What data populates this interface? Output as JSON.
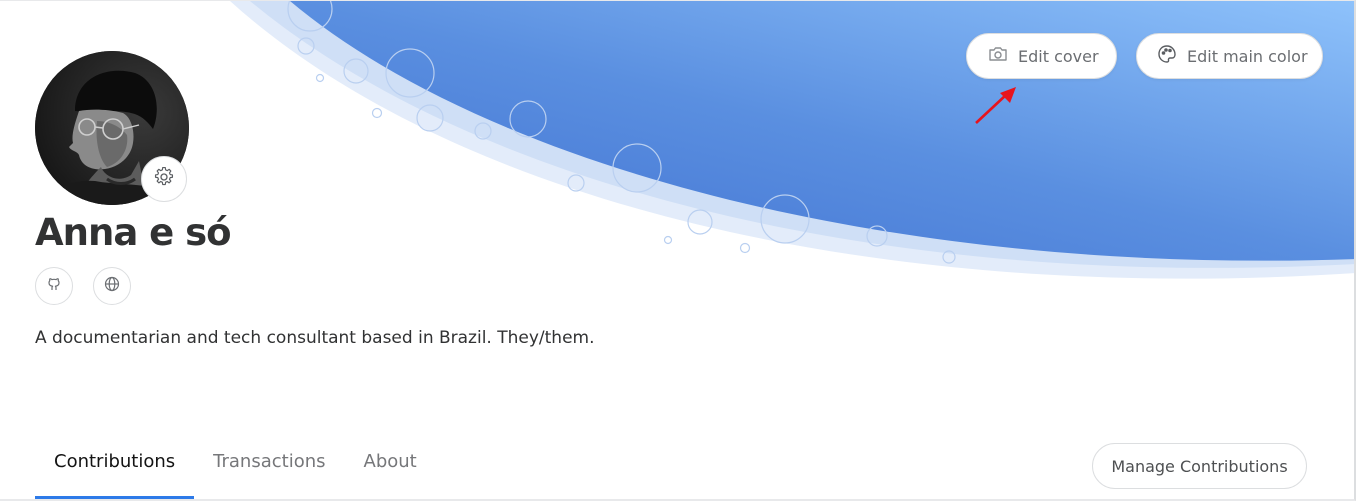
{
  "profile": {
    "name": "Anna e só",
    "bio": "A documentarian and tech consultant based in Brazil. They/them."
  },
  "cover_actions": {
    "edit_cover": "Edit cover",
    "edit_main_color": "Edit main color"
  },
  "social_links": [
    {
      "icon": "github-icon"
    },
    {
      "icon": "globe-icon"
    }
  ],
  "tabs": [
    {
      "label": "Contributions",
      "active": true
    },
    {
      "label": "Transactions",
      "active": false
    },
    {
      "label": "About",
      "active": false
    }
  ],
  "manage_button": "Manage Contributions",
  "colors": {
    "cover_light": "#8ec2fb",
    "cover_dark": "#4a7fd6",
    "tab_accent": "#2d7ae8",
    "annotation_arrow": "#e8141c"
  }
}
